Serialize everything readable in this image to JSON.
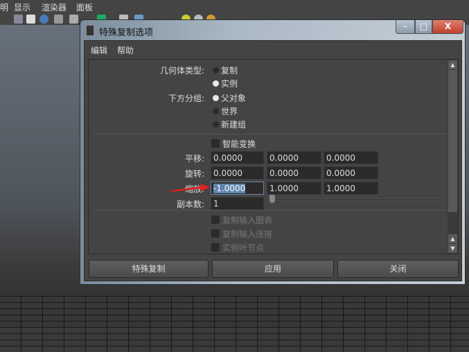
{
  "app_menu": [
    "明",
    "显示",
    "渲染器",
    "面板"
  ],
  "dialog": {
    "title": "特殊复制选项",
    "window_buttons": {
      "minimize": "–",
      "maximize": "□",
      "close": "X"
    },
    "menu": [
      "编辑",
      "帮助"
    ],
    "geometry_type": {
      "label": "几何体类型:",
      "options": [
        {
          "label": "复制",
          "selected": false
        },
        {
          "label": "实例",
          "selected": true
        }
      ]
    },
    "group_under": {
      "label": "下方分组:",
      "options": [
        {
          "label": "父对象",
          "selected": true
        },
        {
          "label": "世界",
          "selected": false
        },
        {
          "label": "新建组",
          "selected": false
        }
      ]
    },
    "smart_transform": {
      "label": "智能变换",
      "checked": false
    },
    "translate": {
      "label": "平移:",
      "values": [
        "0.0000",
        "0.0000",
        "0.0000"
      ]
    },
    "rotate": {
      "label": "旋转:",
      "values": [
        "0.0000",
        "0.0000",
        "0.0000"
      ]
    },
    "scale": {
      "label": "缩放:",
      "values": [
        "-1.0000",
        "1.0000",
        "1.0000"
      ]
    },
    "copies": {
      "label": "副本数:",
      "value": "1",
      "slider_fraction": 0
    },
    "disabled_options": [
      "复制输入图表",
      "复制输入连接",
      "实例叶节点"
    ],
    "buttons": {
      "duplicate_special": "特殊复制",
      "apply": "应用",
      "close": "关闭"
    },
    "annotation_color": "#e0201c"
  }
}
